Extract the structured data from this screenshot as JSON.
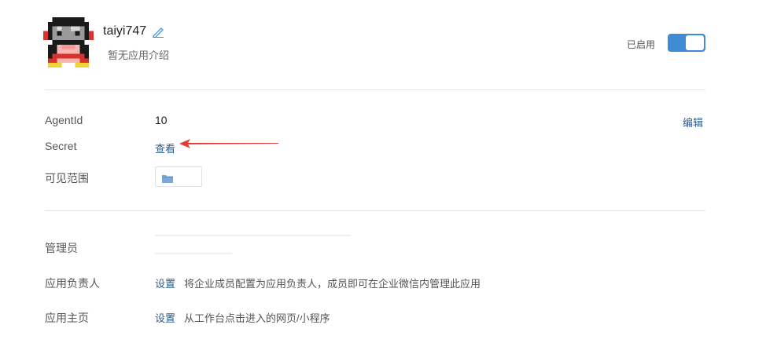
{
  "app": {
    "name": "taiyi747",
    "description": "暂无应用介绍",
    "status_label": "已启用",
    "enabled": true
  },
  "details": {
    "agentid_label": "AgentId",
    "agentid_value": "10",
    "edit_label": "编辑",
    "secret_label": "Secret",
    "secret_view": "查看",
    "scope_label": "可见范围"
  },
  "management": {
    "admin_label": "管理员",
    "owner_label": "应用负责人",
    "owner_set": "设置",
    "owner_hint": "将企业成员配置为应用负责人，成员即可在企业微信内管理此应用",
    "homepage_label": "应用主页",
    "homepage_set": "设置",
    "homepage_hint": "从工作台点击进入的网页/小程序"
  },
  "colors": {
    "accent": "#3f8bd4",
    "link": "#2a5d8f",
    "arrow": "#e53935"
  },
  "icons": [
    "pixel-avatar-icon",
    "edit-pencil-icon",
    "folder-icon",
    "red-arrow-annotation"
  ]
}
